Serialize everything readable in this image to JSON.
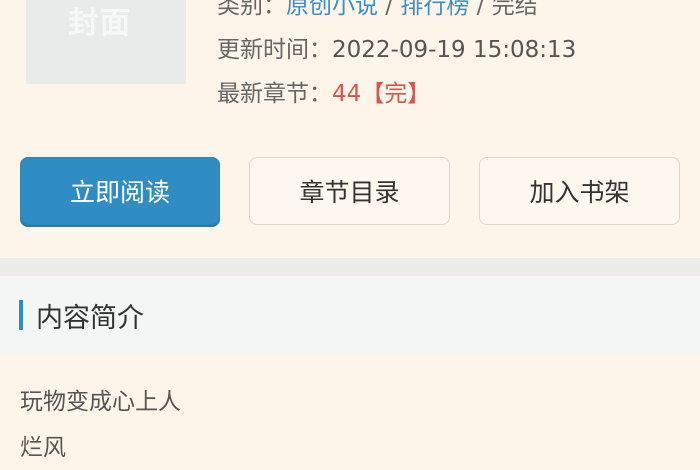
{
  "book": {
    "cover_text": "封面",
    "category_label": "类别：",
    "category_links": [
      "原创小说",
      "排行榜"
    ],
    "category_sep": " / ",
    "status_text": "完结",
    "updated_label": "更新时间：",
    "updated_value": "2022-09-19 15:08:13",
    "latest_label": "最新章节：",
    "latest_value": "44【完】"
  },
  "actions": {
    "read_now": "立即阅读",
    "chapter_list": "章节目录",
    "add_to_shelf": "加入书架"
  },
  "intro": {
    "heading": "内容简介",
    "lines": [
      "玩物变成心上人",
      "烂风"
    ]
  },
  "colors": {
    "accent": "#2f8dc3",
    "latest_chapter": "#d9534f",
    "background": "#fdf5ea"
  }
}
